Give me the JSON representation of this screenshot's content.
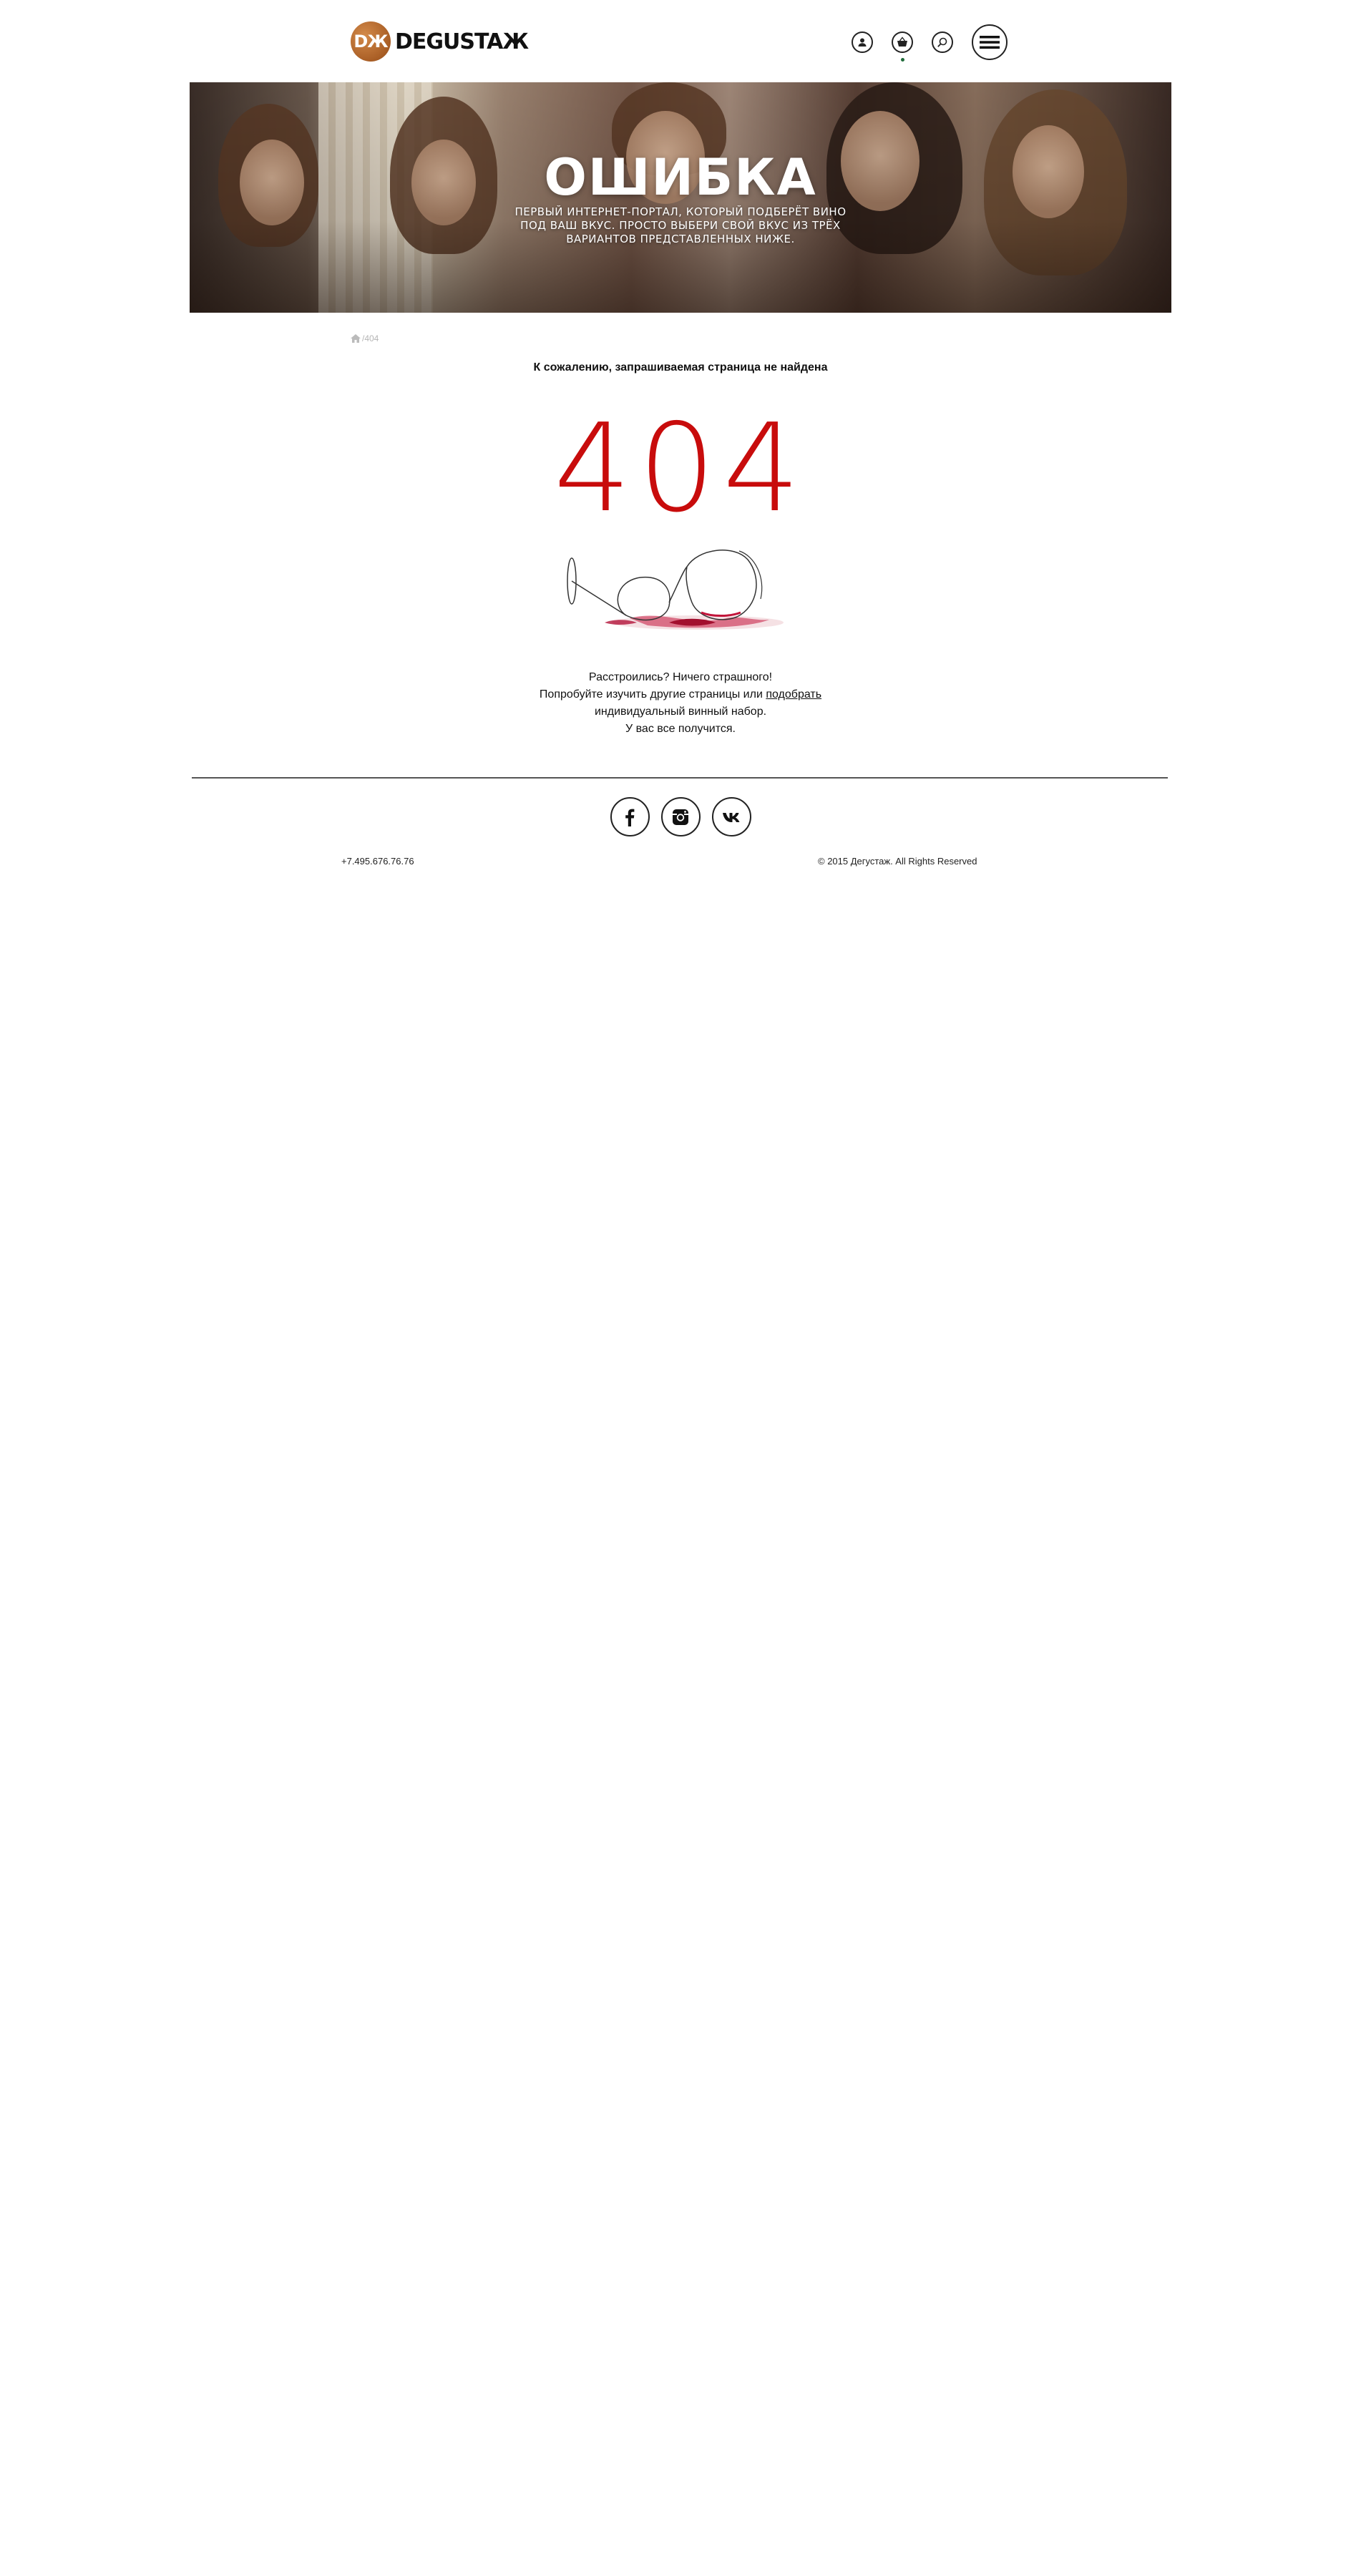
{
  "header": {
    "logo_badge": "DЖ",
    "logo_text": "DEGUSTAЖ",
    "icons": [
      "user-icon",
      "cart-icon",
      "search-icon",
      "menu-icon"
    ]
  },
  "hero": {
    "title": "ОШИБКА",
    "subtitle_lines": [
      "ПЕРВЫЙ ИНТЕРНЕТ-ПОРТАЛ, КОТОРЫЙ ПОДБЕРЁТ ВИНО",
      "ПОД ВАШ ВКУС. ПРОСТО ВЫБЕРИ СВОЙ ВКУС ИЗ ТРЁХ",
      "ВАРИАНТОВ ПРЕДСТАВЛЕННЫХ НИЖЕ."
    ]
  },
  "breadcrumb": {
    "current": "/404"
  },
  "main": {
    "notice": "К сожалению, запрашиваемая страница не найдена",
    "error_code": "404",
    "message_line1": "Расстроились? Ничего страшного!",
    "message_line2_prefix": "Попробуйте изучить другие страницы или ",
    "message_link": "подобрать",
    "message_line3": "индивидуальный винный набор.",
    "message_line4": "У вас все получится."
  },
  "footer": {
    "phone": "+7.495.676.76.76",
    "copyright": "© 2015 Дегустаж. All Rights Reserved",
    "social": [
      "facebook-icon",
      "instagram-icon",
      "vk-icon"
    ]
  },
  "colors": {
    "accent_red": "#c80c0c",
    "logo_orange": "#a95e25",
    "cart_dot": "#1f6b3a"
  }
}
